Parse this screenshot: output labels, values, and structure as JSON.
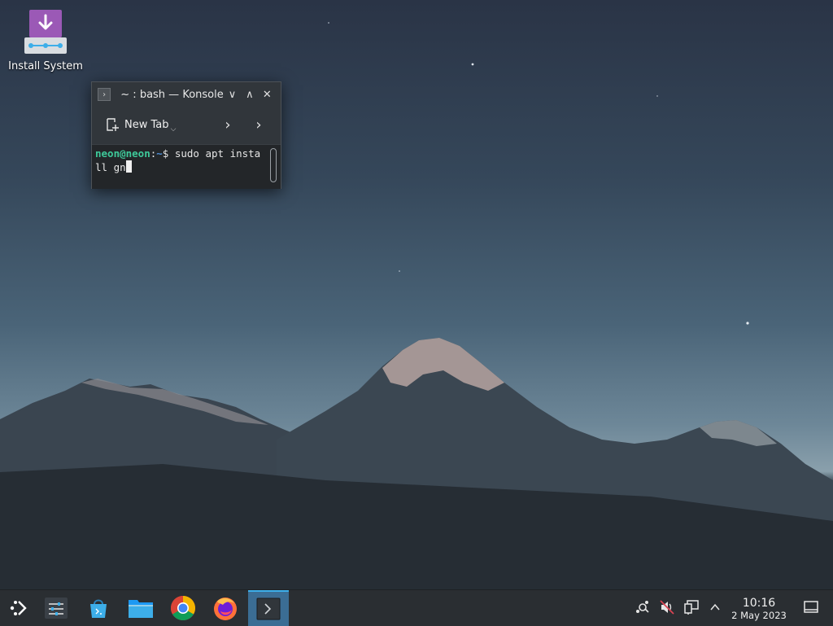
{
  "desktop": {
    "icons": [
      {
        "label": "Install System",
        "icon": "install-system-icon"
      }
    ]
  },
  "konsole": {
    "title": "~ : bash — Konsole",
    "toolbar": {
      "new_tab_label": "New Tab"
    },
    "terminal": {
      "user_host": "neon@neon",
      "separator": ":",
      "path": "~",
      "prompt": "$",
      "command": " sudo apt install gn"
    }
  },
  "taskbar": {
    "clock": {
      "time": "10:16",
      "date": "2 May 2023"
    },
    "tasks": [
      {
        "name": "application-launcher",
        "icon": "kde-launcher-icon"
      },
      {
        "name": "system-settings",
        "icon": "settings-sliders-icon"
      },
      {
        "name": "discover",
        "icon": "store-bag-icon"
      },
      {
        "name": "dolphin",
        "icon": "folder-icon"
      },
      {
        "name": "chrome",
        "icon": "chrome-icon"
      },
      {
        "name": "firefox",
        "icon": "firefox-icon"
      },
      {
        "name": "konsole",
        "icon": "terminal-icon",
        "active": true
      }
    ]
  },
  "colors": {
    "accent": "#3daee9",
    "terminal_user": "#3ec99a",
    "terminal_path": "#4e8fd8"
  }
}
